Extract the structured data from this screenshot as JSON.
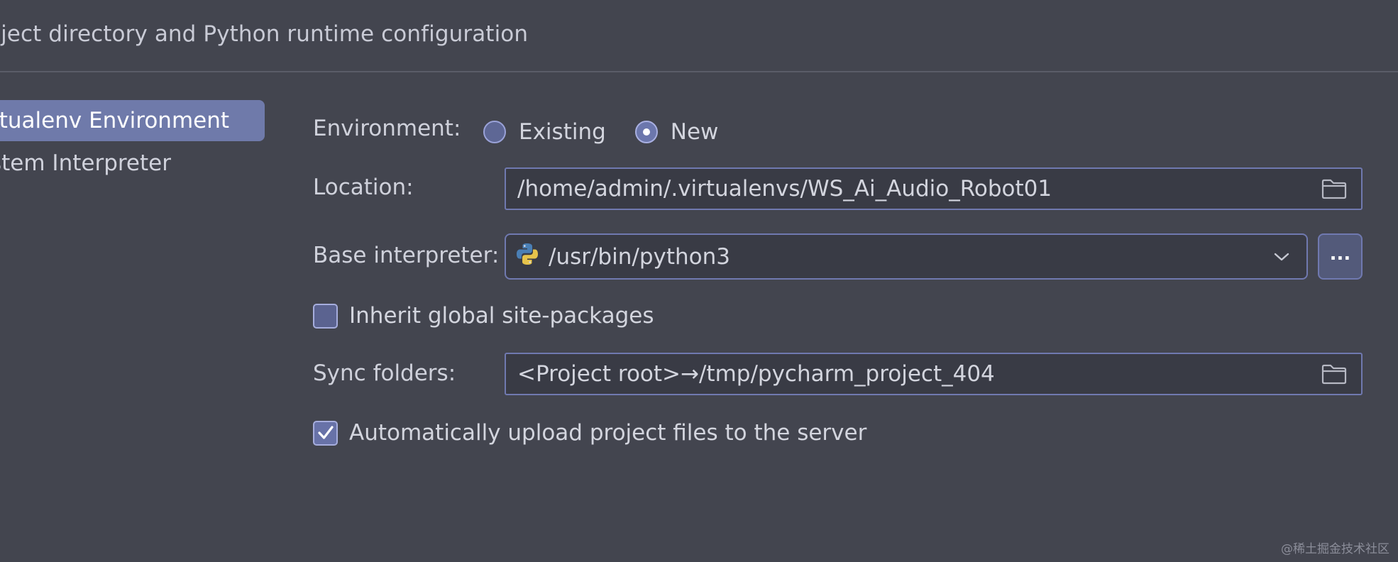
{
  "header": {
    "title": "oject directory and Python runtime configuration"
  },
  "sidebar": {
    "items": [
      {
        "label": "rtualenv Environment",
        "selected": true
      },
      {
        "label": "stem Interpreter",
        "selected": false
      }
    ]
  },
  "form": {
    "environment": {
      "label": "Environment:",
      "options": [
        {
          "label": "Existing",
          "checked": false
        },
        {
          "label": "New",
          "checked": true
        }
      ]
    },
    "location": {
      "label": "Location:",
      "value": "/home/admin/.virtualenvs/WS_Ai_Audio_Robot01",
      "icon": "folder-icon"
    },
    "base_interpreter": {
      "label": "Base interpreter:",
      "value": "/usr/bin/python3",
      "icon": "python-icon",
      "browse_label": "..."
    },
    "inherit_global": {
      "label": "Inherit global site-packages",
      "checked": false
    },
    "sync_folders": {
      "label": "Sync folders:",
      "value": "<Project root>→/tmp/pycharm_project_404",
      "icon": "folder-icon"
    },
    "auto_upload": {
      "label": "Automatically upload project files to the server",
      "checked": true
    }
  },
  "watermark": "@稀土掘金技术社区",
  "colors": {
    "background": "#43454f",
    "accent": "#6f7aaa",
    "field_border": "#7079b0"
  }
}
